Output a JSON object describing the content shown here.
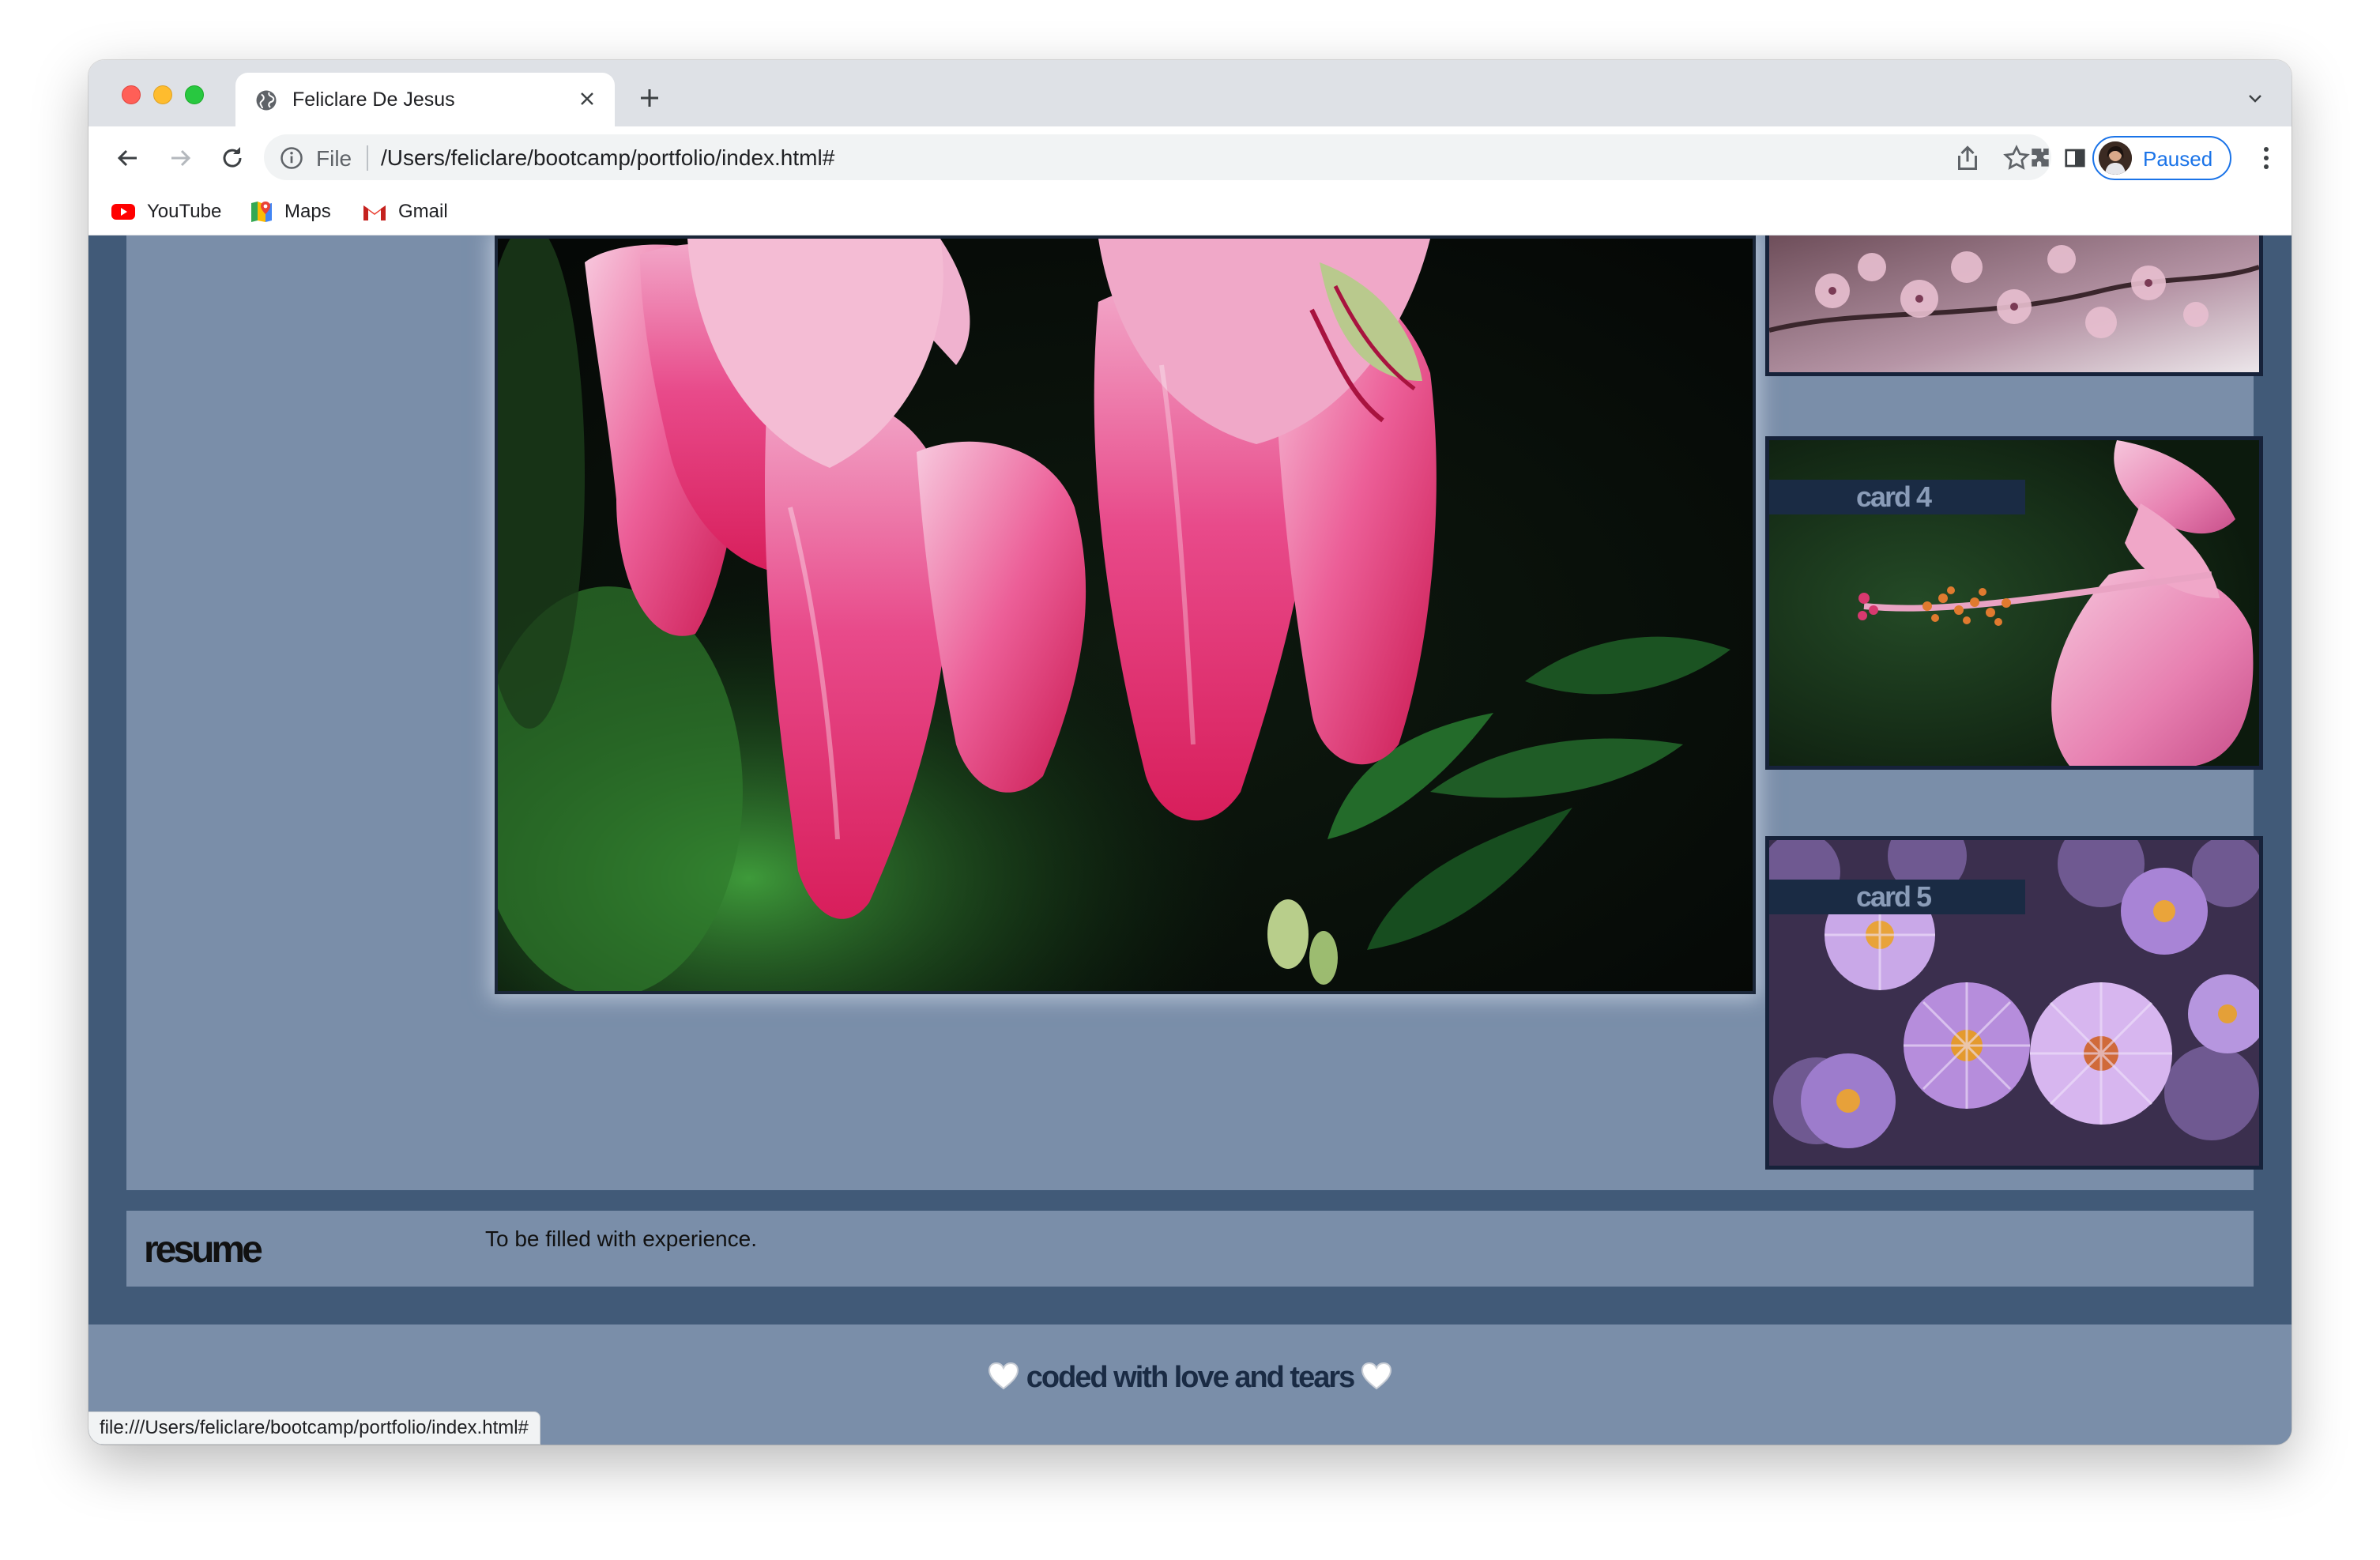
{
  "tab": {
    "title": "Feliclare De Jesus"
  },
  "omnibox": {
    "scheme_label": "File",
    "url": "/Users/feliclare/bootcamp/portfolio/index.html#"
  },
  "profile": {
    "label": "Paused"
  },
  "bookmarks": [
    {
      "label": "YouTube",
      "icon": "youtube-icon"
    },
    {
      "label": "Maps",
      "icon": "maps-icon"
    },
    {
      "label": "Gmail",
      "icon": "gmail-icon"
    }
  ],
  "gallery": {
    "cards": [
      {
        "label": "card 4"
      },
      {
        "label": "card 5"
      }
    ]
  },
  "resume": {
    "title": "resume",
    "text": "To be filled with experience."
  },
  "footer": {
    "text": "coded with love and tears"
  },
  "status_bar": {
    "url": "file:///Users/feliclare/bootcamp/portfolio/index.html#"
  },
  "colors": {
    "page_background": "#415a78",
    "panel": "#7a8ea9",
    "card_border": "#16223a",
    "card_label_bg": "#1a2b44",
    "profile_accent": "#1a73e8"
  }
}
